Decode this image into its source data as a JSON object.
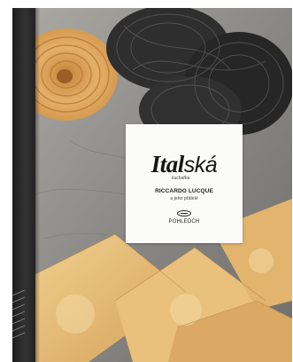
{
  "cover": {
    "title_bold": "Ital",
    "title_light": "ská",
    "subtitle": "kuchařka",
    "author": "RICCARDO LUCQUE",
    "author_sub": "a jeho přátelé",
    "publisher": "POHLEDCH"
  },
  "colors": {
    "spine": "#222222",
    "label_background": "#fbfbfa",
    "pasta_golden": "#d9a45a",
    "pasta_black": "#2b2b2b",
    "stone": "#8d8b87"
  }
}
